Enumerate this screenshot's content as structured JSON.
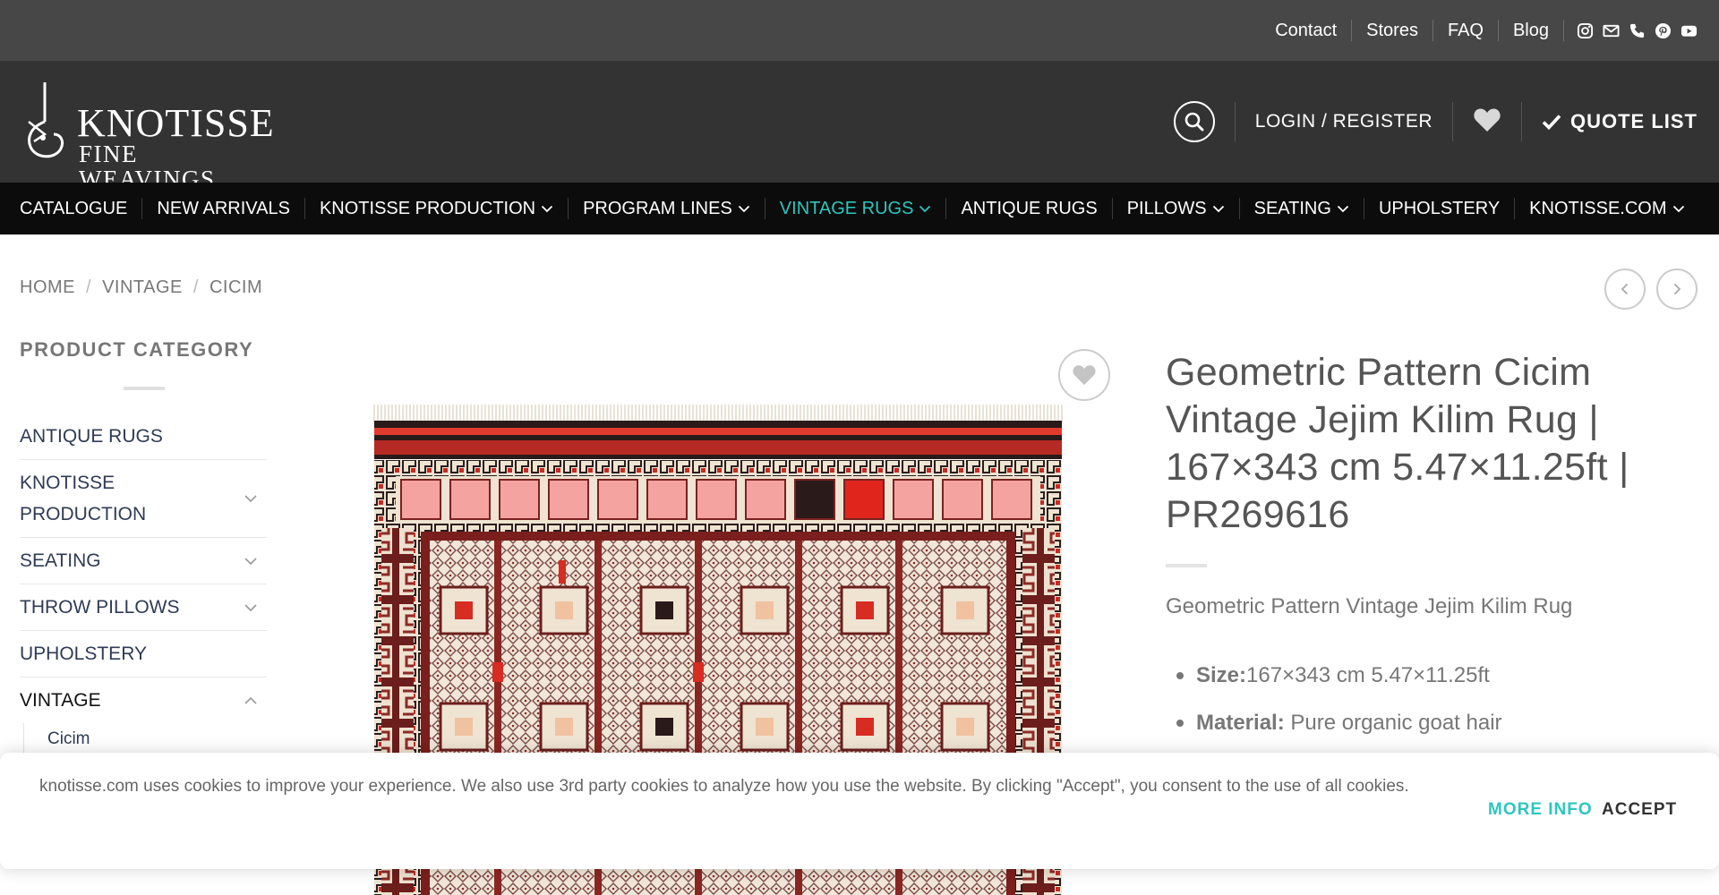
{
  "colors": {
    "topbar_bg": "#474747",
    "header_bg": "#333333",
    "nav_bg": "#0c0c0c",
    "accent": "#2cc7bf",
    "category_text": "#2f3b55"
  },
  "topbar": {
    "links": [
      "Contact",
      "Stores",
      "FAQ",
      "Blog"
    ],
    "social_icons": [
      "instagram-icon",
      "email-icon",
      "phone-icon",
      "pinterest-icon",
      "youtube-icon"
    ]
  },
  "header": {
    "logo_line1": "KNOTISSE",
    "logo_line2": "FINE WEAVINGS",
    "login_label": "LOGIN / REGISTER",
    "quote_label": "QUOTE LIST"
  },
  "nav": {
    "items": [
      {
        "label": "CATALOGUE",
        "dropdown": false,
        "active": false
      },
      {
        "label": "NEW ARRIVALS",
        "dropdown": false,
        "active": false
      },
      {
        "label": "KNOTISSE PRODUCTION",
        "dropdown": true,
        "active": false
      },
      {
        "label": "PROGRAM LINES",
        "dropdown": true,
        "active": false
      },
      {
        "label": "VINTAGE RUGS",
        "dropdown": true,
        "active": true
      },
      {
        "label": "ANTIQUE RUGS",
        "dropdown": false,
        "active": false
      },
      {
        "label": "PILLOWS",
        "dropdown": true,
        "active": false
      },
      {
        "label": "SEATING",
        "dropdown": true,
        "active": false
      },
      {
        "label": "UPHOLSTERY",
        "dropdown": false,
        "active": false
      },
      {
        "label": "KNOTISSE.COM",
        "dropdown": true,
        "active": false
      }
    ]
  },
  "breadcrumb": {
    "items": [
      "HOME",
      "VINTAGE",
      "CICIM"
    ],
    "separator": "/"
  },
  "sidebar": {
    "title": "PRODUCT CATEGORY",
    "categories": [
      {
        "label": "ANTIQUE RUGS",
        "toggle": "none"
      },
      {
        "label": "KNOTISSE PRODUCTION",
        "toggle": "down"
      },
      {
        "label": "SEATING",
        "toggle": "down"
      },
      {
        "label": "THROW PILLOWS",
        "toggle": "down"
      },
      {
        "label": "UPHOLSTERY",
        "toggle": "none"
      },
      {
        "label": "VINTAGE",
        "toggle": "up"
      }
    ],
    "subcategory": "Cicim"
  },
  "product": {
    "title": "Geometric Pattern Cicim Vintage Jejim Kilim Rug | 167×343 cm 5.47×11.25ft | PR269616",
    "subtitle": "Geometric Pattern Vintage Jejim Kilim Rug",
    "specs": [
      {
        "label": "Size:",
        "value": "167×343 cm 5.47×11.25ft"
      },
      {
        "label": "Material:",
        "value": " Pure organic goat hair"
      }
    ]
  },
  "cookie": {
    "text": "knotisse.com uses cookies to improve your experience. We also use 3rd party cookies to analyze how you use the website. By clicking \"Accept\", you consent to the use of all cookies.",
    "more_label": "MORE INFO",
    "accept_label": "ACCEPT"
  }
}
